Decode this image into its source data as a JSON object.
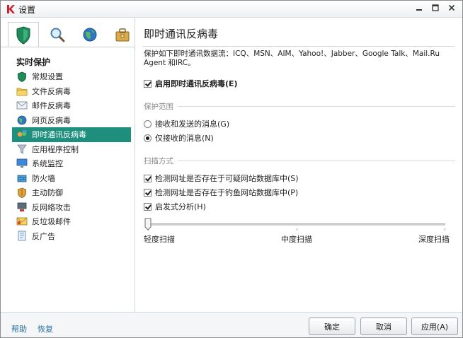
{
  "window": {
    "title": "设置",
    "controls": {
      "minimize": "minimize",
      "maximize": "maximize",
      "close": "close"
    }
  },
  "sidebar": {
    "tabs": [
      {
        "icon": "shield-icon",
        "active": true
      },
      {
        "icon": "magnifier-icon",
        "active": false
      },
      {
        "icon": "globe-icon",
        "active": false
      },
      {
        "icon": "toolbox-icon",
        "active": false
      }
    ],
    "heading": "实时保护",
    "items": [
      {
        "label": "常规设置",
        "icon": "green-shield-icon",
        "active": false
      },
      {
        "label": "文件反病毒",
        "icon": "folder-icon",
        "active": false
      },
      {
        "label": "邮件反病毒",
        "icon": "envelope-icon",
        "active": false
      },
      {
        "label": "网页反病毒",
        "icon": "globe-icon",
        "active": false
      },
      {
        "label": "即时通讯反病毒",
        "icon": "chat-icon",
        "active": true
      },
      {
        "label": "应用程序控制",
        "icon": "funnel-icon",
        "active": false
      },
      {
        "label": "系统监控",
        "icon": "monitor-icon",
        "active": false
      },
      {
        "label": "防火墙",
        "icon": "firewall-icon",
        "active": false
      },
      {
        "label": "主动防御",
        "icon": "shield-icon",
        "active": false
      },
      {
        "label": "反网络攻击",
        "icon": "network-attack-icon",
        "active": false
      },
      {
        "label": "反垃圾邮件",
        "icon": "spam-envelope-icon",
        "active": false
      },
      {
        "label": "反广告",
        "icon": "document-icon",
        "active": false
      }
    ]
  },
  "main": {
    "title": "即时通讯反病毒",
    "description": "保护如下即时通讯数据流：ICQ、MSN、AIM、Yahoo!、Jabber、Google Talk、Mail.Ru Agent 和IRC。",
    "enable": {
      "label": "启用即时通讯反病毒(E)",
      "checked": true
    },
    "protection_scope": {
      "header": "保护范围",
      "options": [
        {
          "label": "接收和发送的消息(G)",
          "selected": false
        },
        {
          "label": "仅接收的消息(N)",
          "selected": true
        }
      ]
    },
    "scan_methods": {
      "header": "扫描方式",
      "options": [
        {
          "label": "检测网址是否存在于可疑网站数据库中(S)",
          "checked": true
        },
        {
          "label": "检测网址是否存在于钓鱼网站数据库中(P)",
          "checked": true
        },
        {
          "label": "启发式分析(H)",
          "checked": true
        }
      ]
    },
    "scan_level": {
      "labels": [
        "轻度扫描",
        "中度扫描",
        "深度扫描"
      ],
      "value": 0
    }
  },
  "footer": {
    "help": "帮助",
    "restore": "恢复",
    "ok": "确定",
    "cancel": "取消",
    "apply": "应用(A)"
  },
  "colors": {
    "accent": "#1f8f7d",
    "link": "#2a6f9b"
  }
}
